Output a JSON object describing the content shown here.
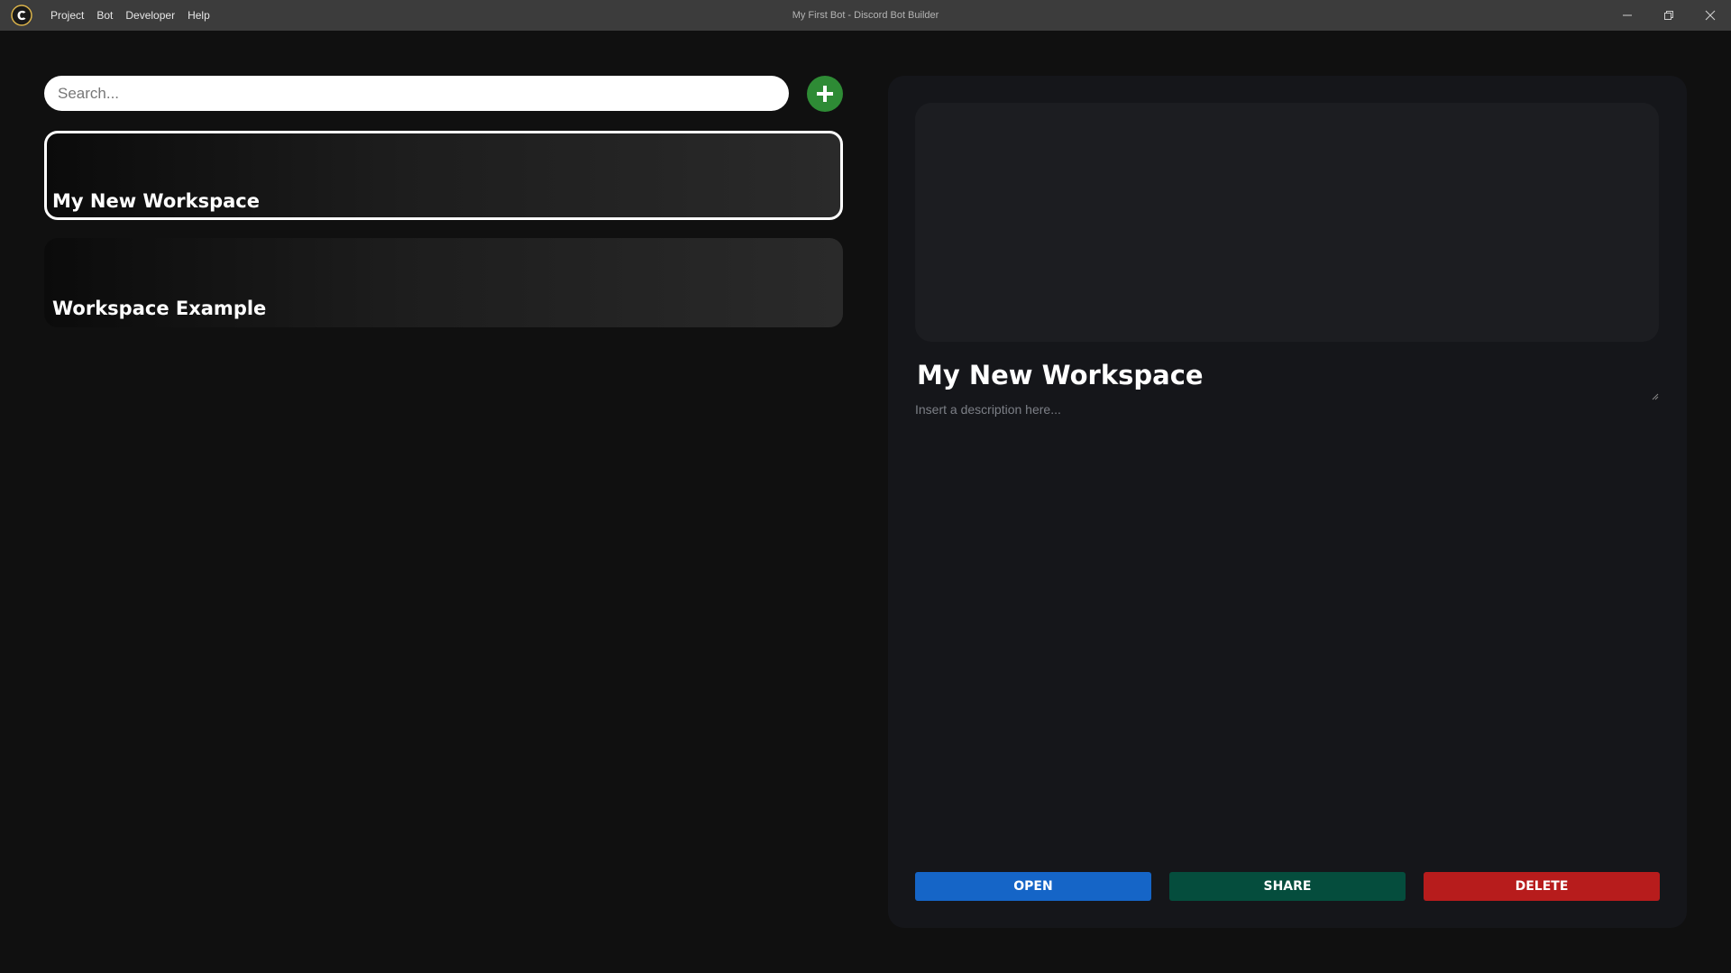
{
  "titlebar": {
    "window_title": "My First Bot - Discord Bot Builder",
    "menu": [
      "Project",
      "Bot",
      "Developer",
      "Help"
    ]
  },
  "search": {
    "placeholder": "Search..."
  },
  "workspaces": [
    {
      "label": "My New Workspace",
      "selected": true
    },
    {
      "label": "Workspace Example",
      "selected": false
    }
  ],
  "detail": {
    "title": "My New Workspace",
    "description_placeholder": "Insert a description here...",
    "open_label": "OPEN",
    "share_label": "SHARE",
    "delete_label": "DELETE"
  },
  "colors": {
    "open": "#1565c7",
    "share": "#054d3d",
    "delete": "#b71c1c",
    "add": "#2e8b35"
  }
}
